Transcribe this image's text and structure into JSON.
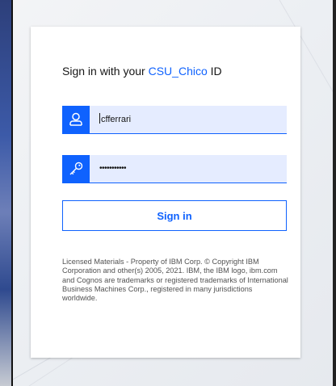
{
  "login": {
    "title_prefix": "Sign in with your ",
    "org_name": "CSU_Chico",
    "title_suffix": " ID",
    "username_value": "cfferrari",
    "password_value": "•••••••••••",
    "signin_label": "Sign in",
    "legal_text": "Licensed Materials - Property of IBM Corp. © Copyright IBM Corporation and other(s) 2005, 2021. IBM, the IBM logo, ibm.com and Cognos are trademarks or registered trademarks of International Business Machines Corp., registered in many jurisdictions worldwide."
  },
  "icons": {
    "username": "user-icon",
    "password": "key-icon"
  },
  "colors": {
    "accent": "#0f62fe",
    "field_bg": "#e5ecff",
    "text": "#161616",
    "muted": "#525252"
  }
}
